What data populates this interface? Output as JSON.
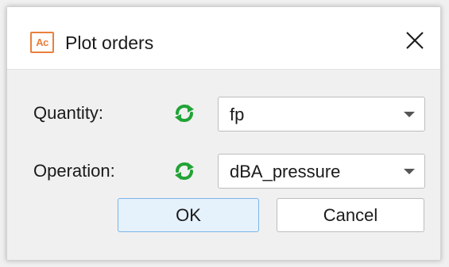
{
  "window": {
    "app_icon_text": "Ac",
    "title": "Plot orders",
    "close_icon": "close-icon"
  },
  "form": {
    "quantity": {
      "label": "Quantity:",
      "value": "fp",
      "refresh_icon": "refresh-icon"
    },
    "operation": {
      "label": "Operation:",
      "value": "dBA_pressure",
      "refresh_icon": "refresh-icon"
    }
  },
  "buttons": {
    "ok_label": "OK",
    "cancel_label": "Cancel"
  },
  "colors": {
    "accent_icon": "#e8803c",
    "refresh_green": "#21a336",
    "default_button_border": "#7eb4ea"
  }
}
